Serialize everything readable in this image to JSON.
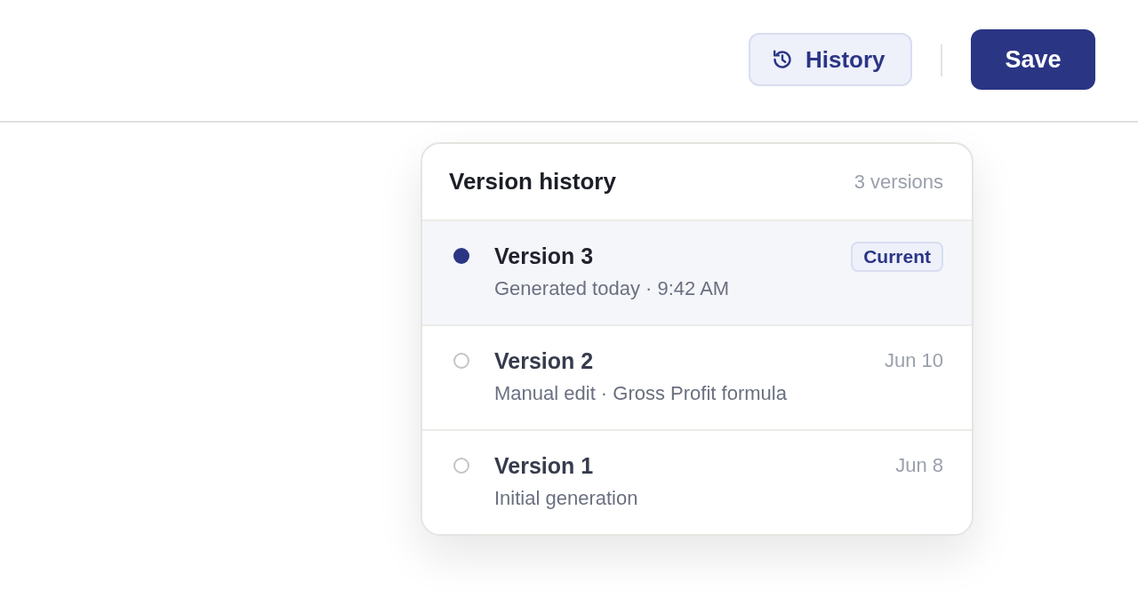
{
  "toolbar": {
    "history_button": {
      "label": "History"
    },
    "save_button": {
      "label": "Save"
    }
  },
  "version_history": {
    "title": "Version history",
    "count": "3 versions",
    "versions": [
      {
        "name": "Version 3",
        "detail": "Generated today · 9:42 AM",
        "badge": "Current",
        "selected": true
      },
      {
        "name": "Version 2",
        "detail": "Manual edit · Gross Profit formula",
        "date": "Jun 10",
        "selected": false
      },
      {
        "name": "Version 1",
        "detail": "Initial generation",
        "date": "Jun 8",
        "selected": false
      }
    ]
  }
}
